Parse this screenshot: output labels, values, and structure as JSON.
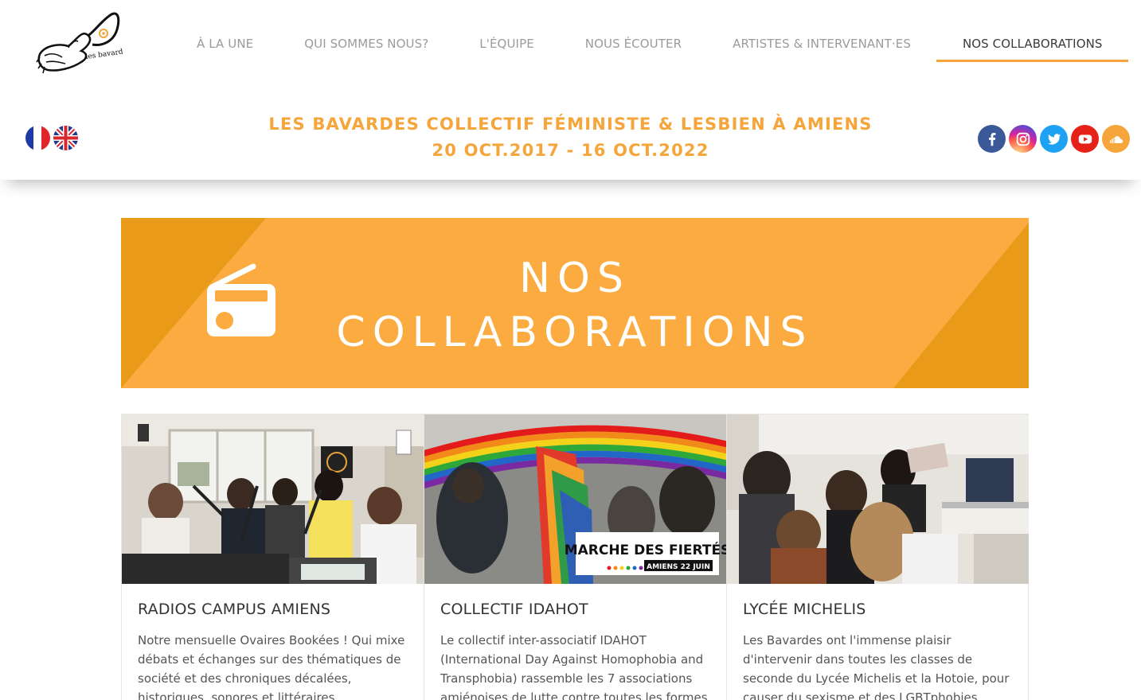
{
  "nav": {
    "items": [
      {
        "label": "À LA UNE"
      },
      {
        "label": "QUI SOMMES NOUS?"
      },
      {
        "label": "L'ÉQUIPE"
      },
      {
        "label": "NOUS ÉCOUTER"
      },
      {
        "label": "ARTISTES & INTERVENANT·ES"
      },
      {
        "label": "NOS COLLABORATIONS"
      }
    ],
    "active_index": 5
  },
  "header": {
    "tagline_line1": "LES BAVARDES COLLECTIF FÉMINISTE & LESBIEN À AMIENS",
    "tagline_line2": "20 OCT.2017 - 16 OCT.2022",
    "logo_text": "les bavardes"
  },
  "languages": [
    {
      "icon": "french-flag-icon"
    },
    {
      "icon": "uk-flag-icon"
    }
  ],
  "social": [
    {
      "icon": "facebook-icon",
      "color": "#3b5998"
    },
    {
      "icon": "instagram-icon",
      "color": "#c13584"
    },
    {
      "icon": "twitter-icon",
      "color": "#1da1f2"
    },
    {
      "icon": "youtube-icon",
      "color": "#e62117"
    },
    {
      "icon": "soundcloud-icon",
      "color": "#f5a53a"
    }
  ],
  "banner": {
    "title_line1": "NOS",
    "title_line2": "COLLABORATIONS",
    "icon": "radio-icon",
    "color_light": "#fbab3f",
    "color_dark": "#e99a19"
  },
  "cards": [
    {
      "title": "RADIOS CAMPUS AMIENS",
      "text": "Notre mensuelle Ovaires Bookées ! Qui mixe débats et échanges sur des thématiques de société et des chroniques décalées, historiques, sonores et littéraires."
    },
    {
      "title": "COLLECTIF IDAHOT",
      "text": "Le collectif inter-associatif IDAHOT (International Day Against Homophobia and Transphobia) rassemble les 7 associations amiénoises de lutte contre toutes les formes",
      "image_caption_line1": "MARCHE DES FIERTÉS",
      "image_caption_line2": "AMIENS 22 JUIN"
    },
    {
      "title": "LYCÉE MICHELIS",
      "text": "Les Bavardes ont l'immense plaisir d'intervenir dans toutes les classes de seconde du Lycée Michelis et la Hotoie, pour causer du sexisme et des LGBTphobies."
    }
  ],
  "colors": {
    "accent": "#f5a53a"
  }
}
